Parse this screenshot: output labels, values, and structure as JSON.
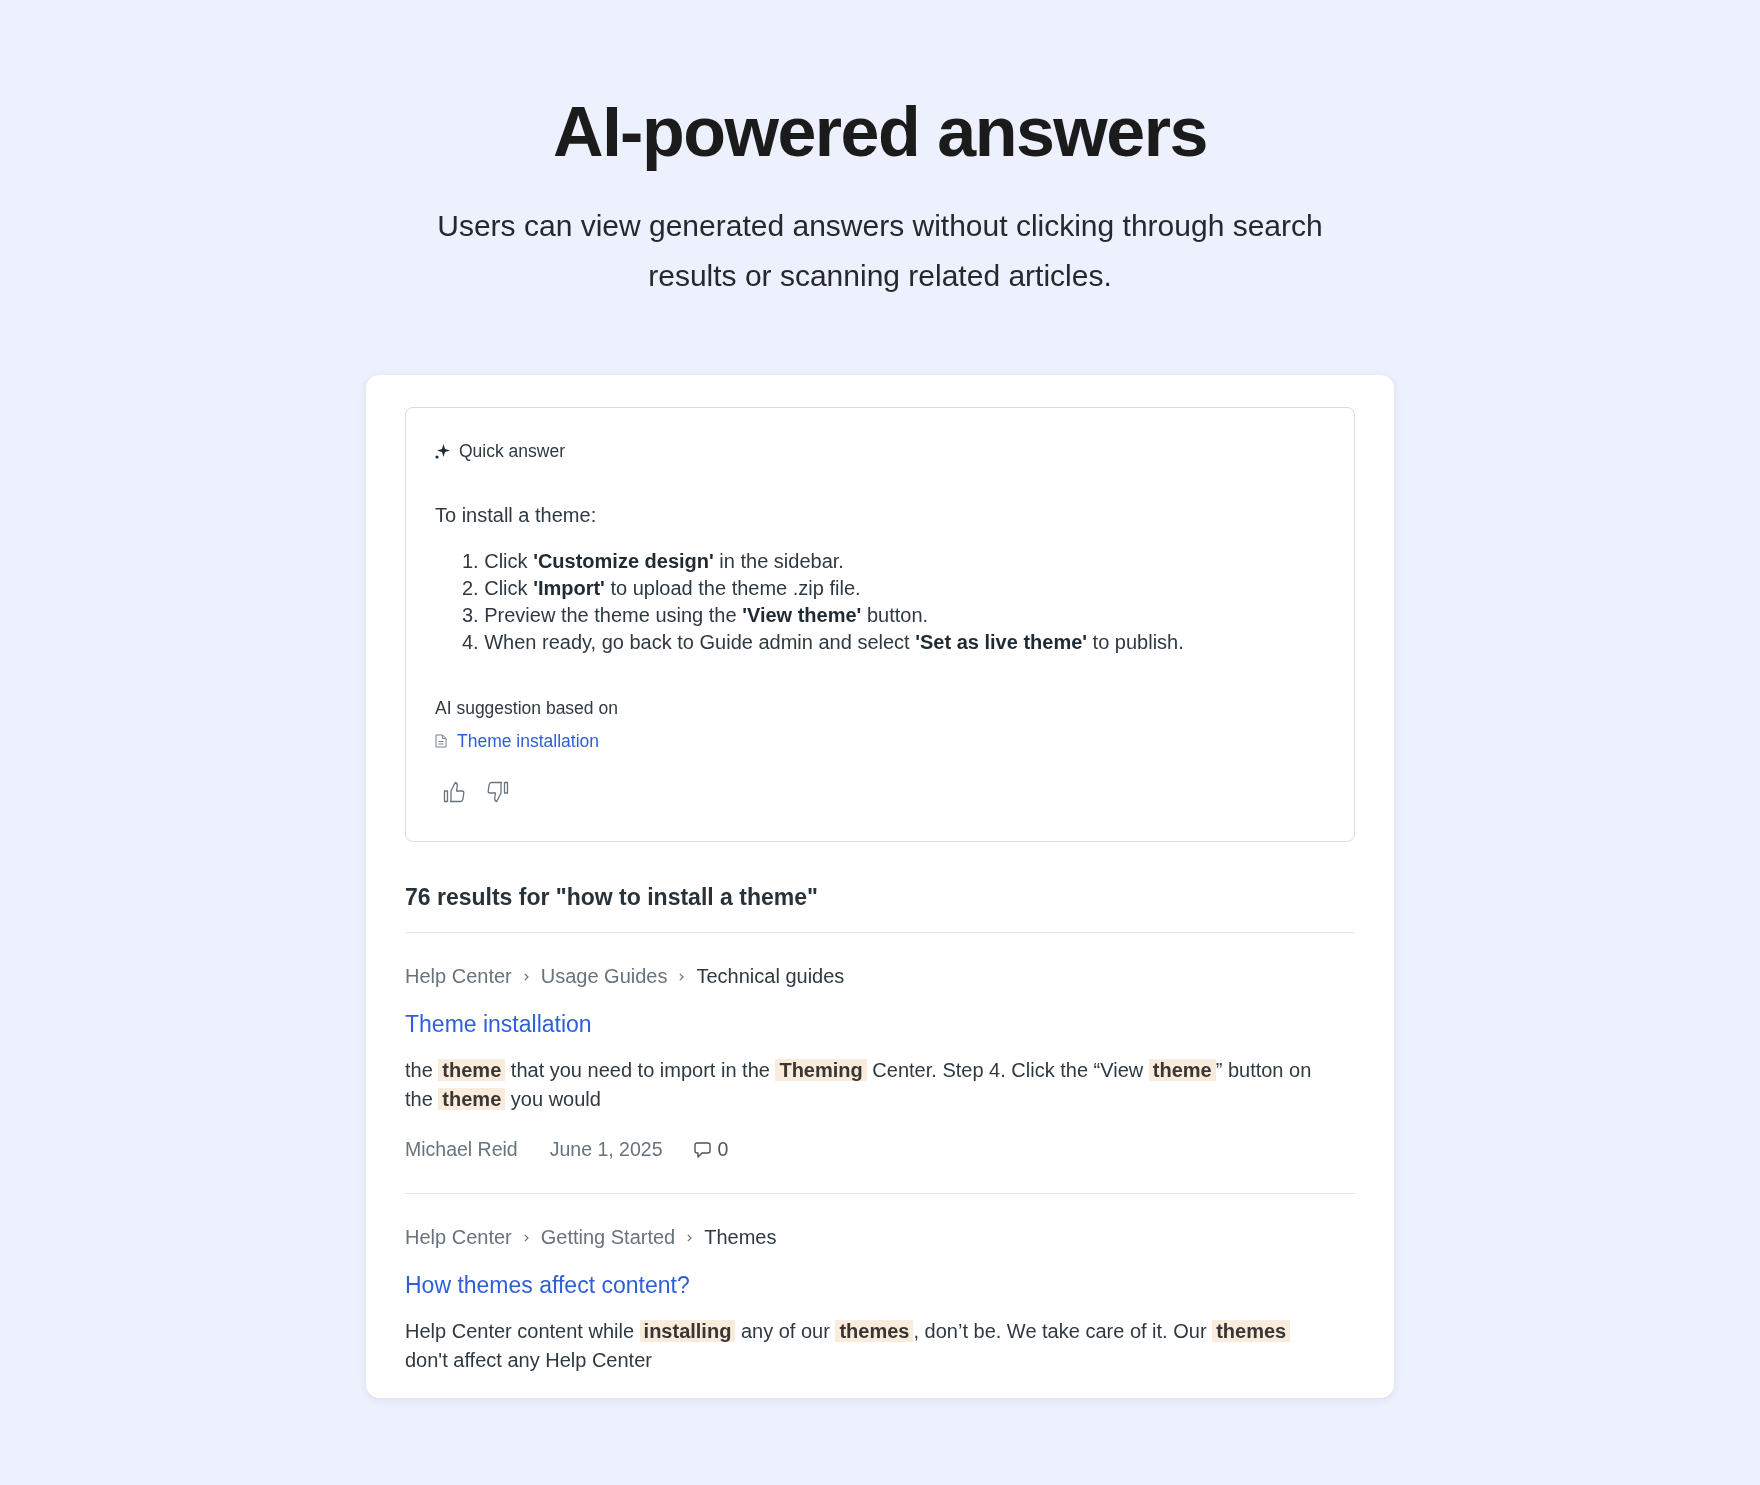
{
  "header": {
    "title": "AI-powered answers",
    "subtitle": "Users can view generated answers without clicking through search results or scanning related articles."
  },
  "quick_answer": {
    "label": "Quick answer",
    "intro": "To install a theme:",
    "steps": [
      "1. Click **'Customize design'** in the sidebar.",
      "2. Click **'Import'** to upload the theme .zip file.",
      "3. Preview the theme using the **'View theme'** button.",
      "4. When ready, go back to Guide admin and select **'Set as live theme'** to publish."
    ],
    "source_label": "AI suggestion based on",
    "source_link": "Theme installation"
  },
  "results": {
    "heading": "76 results for \"how to install a theme\"",
    "items": [
      {
        "breadcrumbs": [
          "Help Center",
          "Usage Guides",
          "Technical guides"
        ],
        "title": "Theme installation",
        "snippet": "the **theme** that you need to import in the **Theming** Center. Step 4. Click the “View **theme**” button on the **theme** you would",
        "author": "Michael Reid",
        "date": "June 1, 2025",
        "comments": "0"
      },
      {
        "breadcrumbs": [
          "Help Center",
          "Getting Started",
          "Themes"
        ],
        "title": "How themes affect content?",
        "snippet": "Help Center content while **installing** any of our **themes**, don’t be. We take care of it. Our **themes** don't affect any Help Center"
      }
    ]
  }
}
